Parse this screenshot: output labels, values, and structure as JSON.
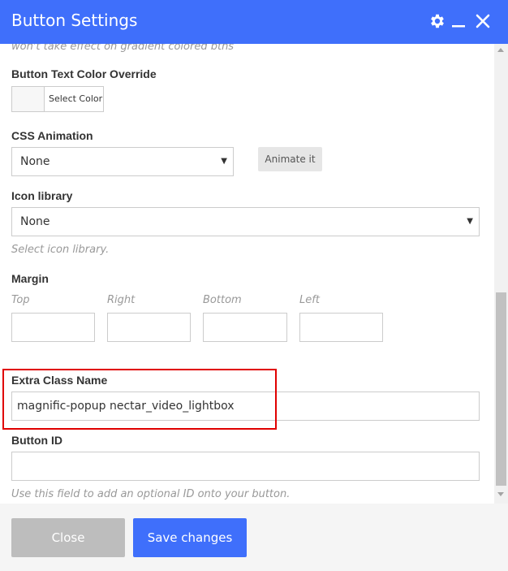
{
  "window": {
    "title": "Button Settings",
    "accent_color": "#3f6ffb",
    "icons": [
      "gear-icon",
      "minimize-icon",
      "close-icon"
    ]
  },
  "fields": {
    "gradient_hint": "won't take effect on gradient colored btns",
    "text_color": {
      "label": "Button Text Color Override",
      "button_label": "Select Color"
    },
    "css_animation": {
      "label": "CSS Animation",
      "value": "None",
      "animate_button": "Animate it"
    },
    "icon_library": {
      "label": "Icon library",
      "value": "None",
      "hint": "Select icon library."
    },
    "margin": {
      "label": "Margin",
      "top": "Top",
      "right": "Right",
      "bottom": "Bottom",
      "left": "Left"
    },
    "extra_class": {
      "label": "Extra Class Name",
      "value": "magnific-popup nectar_video_lightbox",
      "highlight_color": "#e00000"
    },
    "button_id": {
      "label": "Button ID",
      "value": "",
      "hint": "Use this field to add an optional ID onto your button."
    }
  },
  "footer": {
    "close_label": "Close",
    "save_label": "Save changes"
  }
}
